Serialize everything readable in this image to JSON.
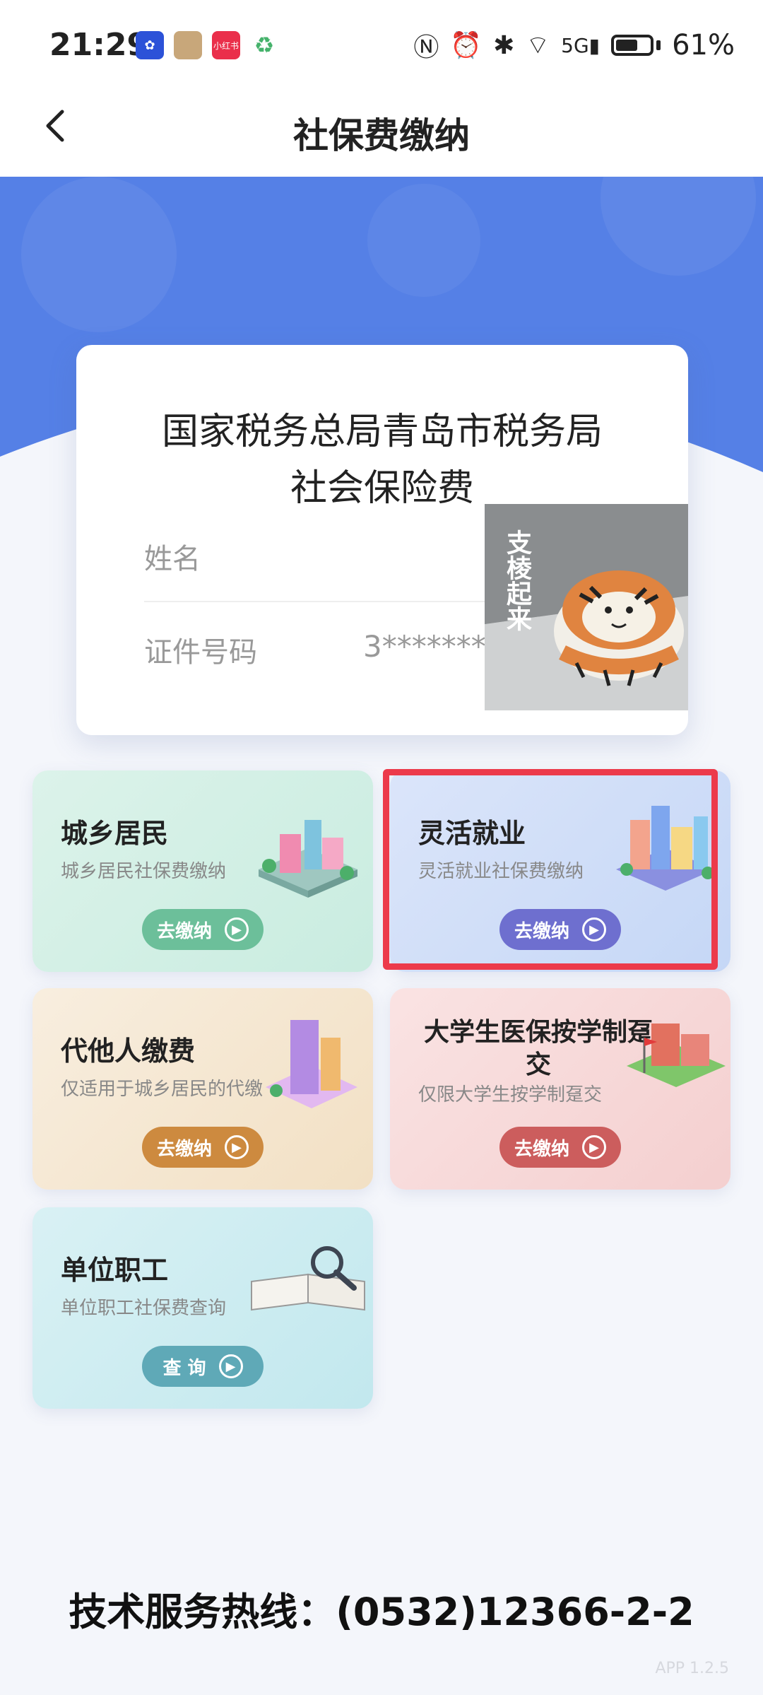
{
  "status_bar": {
    "time": "21:29",
    "battery_percent": "61%",
    "apps": [
      {
        "icon": "app-badge-blue-icon",
        "color": "#2c52d8",
        "label": ""
      },
      {
        "icon": "app-photo-icon",
        "color": "#c8a77a",
        "label": ""
      },
      {
        "icon": "app-xiaohongshu-icon",
        "color": "#ea2f4b",
        "label": "小红书"
      },
      {
        "icon": "app-recycle-icon",
        "color": "#45b26b",
        "label": ""
      }
    ]
  },
  "header": {
    "title": "社保费缴纳"
  },
  "info_card": {
    "agency_line1": "国家税务总局青岛市税务局",
    "agency_line2": "社会保险费",
    "name_label": "姓名",
    "id_label": "证件号码",
    "id_value": "3********",
    "photo_caption": "支棱起来"
  },
  "tiles": [
    {
      "title": "城乡居民",
      "subtitle": "城乡居民社保费缴纳",
      "button": "去缴纳",
      "accent": "#6cbf9a"
    },
    {
      "title": "灵活就业",
      "subtitle": "灵活就业社保费缴纳",
      "button": "去缴纳",
      "accent": "#6e6fcf"
    },
    {
      "title": "代他人缴费",
      "subtitle": "仅适用于城乡居民的代缴",
      "button": "去缴纳",
      "accent": "#cd8a3f"
    },
    {
      "title": "大学生医保按学制趸交",
      "subtitle": "仅限大学生按学制趸交",
      "button": "去缴纳",
      "accent": "#cc5d5d"
    },
    {
      "title": "单位职工",
      "subtitle": "单位职工社保费查询",
      "button": "查 询",
      "accent": "#5fa9b7"
    }
  ],
  "footer": {
    "hotline": "技术服务热线：(0532)12366-2-2",
    "version": "APP 1.2.5"
  }
}
